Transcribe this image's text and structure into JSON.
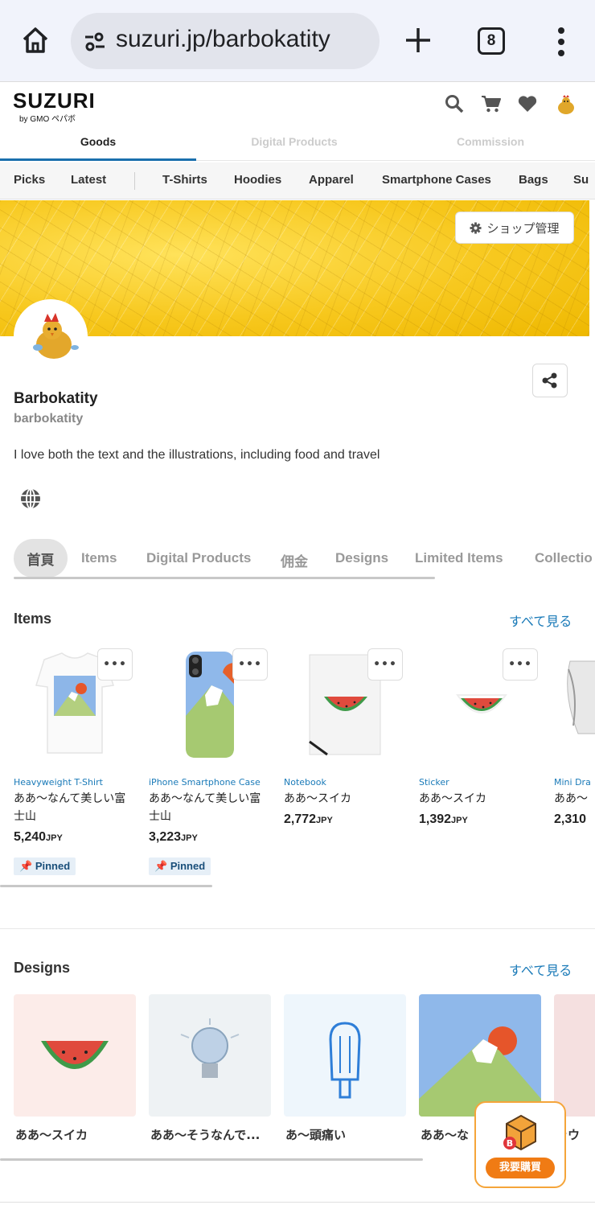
{
  "browser": {
    "url": "suzuri.jp/barbokatity",
    "tab_count": "8"
  },
  "header": {
    "logo": "SUZURI",
    "logo_sub": "by GMO ペパボ",
    "main_tabs": [
      {
        "label": "Goods",
        "active": true
      },
      {
        "label": "Digital Products",
        "active": false
      },
      {
        "label": "Commission",
        "active": false
      }
    ],
    "categories": [
      "Picks",
      "Latest",
      "T-Shirts",
      "Hoodies",
      "Apparel",
      "Smartphone Cases",
      "Bags",
      "Su"
    ]
  },
  "shop": {
    "manage_label": "ショップ管理",
    "name": "Barbokatity",
    "handle": "barbokatity",
    "bio": "I love both the text and the illustrations, including food and travel",
    "tabs": [
      "首頁",
      "Items",
      "Digital Products",
      "佣金",
      "Designs",
      "Limited Items",
      "Collectio"
    ]
  },
  "items_section": {
    "title": "Items",
    "see_all": "すべて見る",
    "more_label": "•••",
    "items": [
      {
        "type": "Heavyweight T-Shirt",
        "name": "ああ〜なんて美しい富士山",
        "price": "5,240",
        "currency": "JPY",
        "pinned": "Pinned"
      },
      {
        "type": "iPhone Smartphone Case",
        "name": "ああ〜なんて美しい富士山",
        "price": "3,223",
        "currency": "JPY",
        "pinned": "Pinned"
      },
      {
        "type": "Notebook",
        "name": "ああ〜スイカ",
        "price": "2,772",
        "currency": "JPY"
      },
      {
        "type": "Sticker",
        "name": "ああ〜スイカ",
        "price": "1,392",
        "currency": "JPY"
      },
      {
        "type": "Mini Dra",
        "name": "ああ〜",
        "price": "2,310",
        "currency": ""
      }
    ]
  },
  "designs_section": {
    "title": "Designs",
    "see_all": "すべて見る",
    "designs": [
      {
        "label": "ああ〜スイカ"
      },
      {
        "label": "ああ〜そうなんで..."
      },
      {
        "label": "あ〜頭痛い"
      },
      {
        "label": "ああ〜な"
      },
      {
        "label": "ラウ"
      }
    ]
  },
  "buy_badge": {
    "label": "我要購買",
    "letter": "B"
  },
  "colors": {
    "accent": "#1a6fad",
    "link": "#1a7ab8",
    "banner": "#f7c81e",
    "buy": "#f07b14"
  }
}
